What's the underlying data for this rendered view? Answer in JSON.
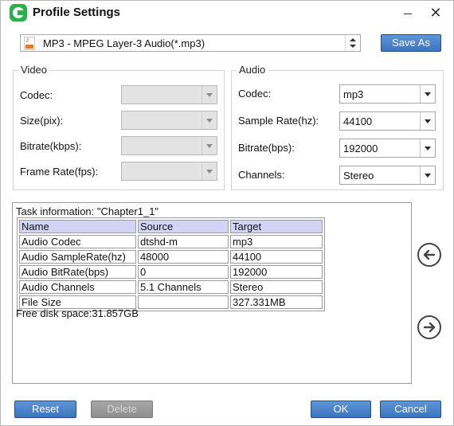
{
  "window": {
    "title": "Profile Settings",
    "minimize_icon": "minimize-icon",
    "close_icon": "close-icon",
    "close_glyph": "✕"
  },
  "profile": {
    "selected": "MP3 - MPEG Layer-3 Audio(*.mp3)",
    "icon": "mp3-file-icon",
    "save_as_label": "Save As"
  },
  "video": {
    "legend": "Video",
    "fields": [
      {
        "label": "Codec:",
        "value": ""
      },
      {
        "label": "Size(pix):",
        "value": ""
      },
      {
        "label": "Bitrate(kbps):",
        "value": ""
      },
      {
        "label": "Frame Rate(fps):",
        "value": ""
      }
    ]
  },
  "audio": {
    "legend": "Audio",
    "fields": [
      {
        "label": "Codec:",
        "value": "mp3"
      },
      {
        "label": "Sample Rate(hz):",
        "value": "44100"
      },
      {
        "label": "Bitrate(bps):",
        "value": "192000"
      },
      {
        "label": "Channels:",
        "value": "Stereo"
      }
    ]
  },
  "task": {
    "info": "Task information: \"Chapter1_1\"",
    "headers": [
      "Name",
      "Source",
      "Target"
    ],
    "rows": [
      [
        "Audio Codec",
        "dtshd-m",
        "mp3"
      ],
      [
        "Audio SampleRate(hz)",
        "48000",
        "44100"
      ],
      [
        "Audio BitRate(bps)",
        "0",
        "192000"
      ],
      [
        "Audio Channels",
        "5.1 Channels",
        "Stereo"
      ],
      [
        "File Size",
        "",
        "327.331MB"
      ]
    ],
    "free_disk": "Free disk space:31.857GB"
  },
  "nav": {
    "left_icon": "arrow-left-circle-icon",
    "right_icon": "arrow-right-circle-icon"
  },
  "buttons": {
    "reset": "Reset",
    "delete": "Delete",
    "ok": "OK",
    "cancel": "Cancel"
  },
  "colors": {
    "button_blue": "#4a82cc",
    "button_disabled": "#9a9a9a",
    "table_header": "#d3d3f5",
    "app_icon_green": "#27b34a"
  }
}
